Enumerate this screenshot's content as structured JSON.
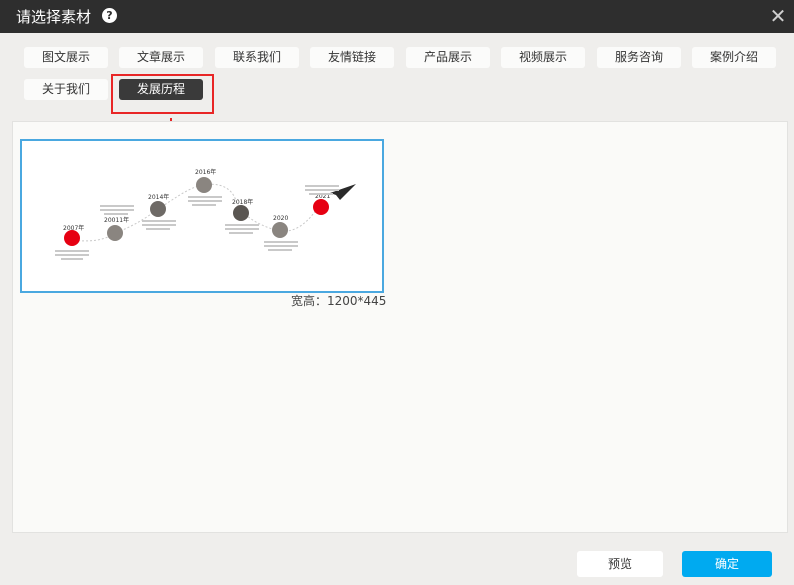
{
  "dialog": {
    "title": "请选择素材",
    "help_icon": "?",
    "close_icon": "✕"
  },
  "tabs": [
    {
      "label": "图文展示",
      "active": false
    },
    {
      "label": "文章展示",
      "active": false
    },
    {
      "label": "联系我们",
      "active": false
    },
    {
      "label": "友情链接",
      "active": false
    },
    {
      "label": "产品展示",
      "active": false
    },
    {
      "label": "视频展示",
      "active": false
    },
    {
      "label": "服务咨询",
      "active": false
    },
    {
      "label": "案例介绍",
      "active": false
    },
    {
      "label": "关于我们",
      "active": false
    },
    {
      "label": "发展历程",
      "active": true
    }
  ],
  "material": {
    "size_text": "宽高：1200*445",
    "timeline_years": [
      "2007年",
      "20011年",
      "2014年",
      "2016年",
      "2018年",
      "2020",
      "2021"
    ]
  },
  "buttons": {
    "preview": "预览",
    "confirm": "确定"
  },
  "colors": {
    "accent": "#00aaf0",
    "highlight": "#e82626",
    "active_tab": "#3a3a3a",
    "titlebar": "#2e2e2e"
  }
}
